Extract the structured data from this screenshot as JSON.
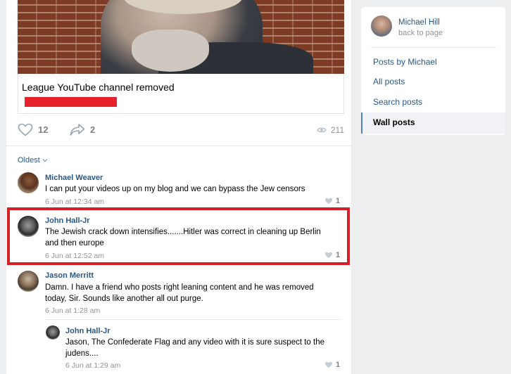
{
  "post": {
    "link_title": "League YouTube channel removed",
    "likes": "12",
    "shares": "2",
    "views": "211"
  },
  "comments_sort": "Oldest",
  "comments": [
    {
      "name": "Michael Weaver",
      "text": "I can put your videos up on my blog and we can bypass the Jew censors",
      "date": "6 Jun at 12:34 am",
      "likes": "1"
    },
    {
      "name": "John Hall-Jr",
      "text": "The Jewish crack down intensifies.......Hitler was correct in cleaning up Berlin and then europe",
      "date": "6 Jun at 12:52 am",
      "likes": "1"
    },
    {
      "name": "Jason Merritt",
      "text": "Damn. I have a friend who posts right leaning content and he was removed today, Sir. Sounds like another all out purge.",
      "date": "6 Jun at 1:28 am",
      "likes": ""
    },
    {
      "name": "John Hall-Jr",
      "text": "Jason, The Confederate Flag and any video with it is sure suspect to the judens....",
      "date": "6 Jun at 1:29 am",
      "likes": "1"
    }
  ],
  "sidebar": {
    "name": "Michael Hill",
    "subtitle": "back to page",
    "items": [
      "Posts by Michael",
      "All posts",
      "Search posts",
      "Wall posts"
    ]
  },
  "colors": {
    "link": "#2a5885",
    "highlight": "#d61f26",
    "redaction": "#e8222b"
  }
}
